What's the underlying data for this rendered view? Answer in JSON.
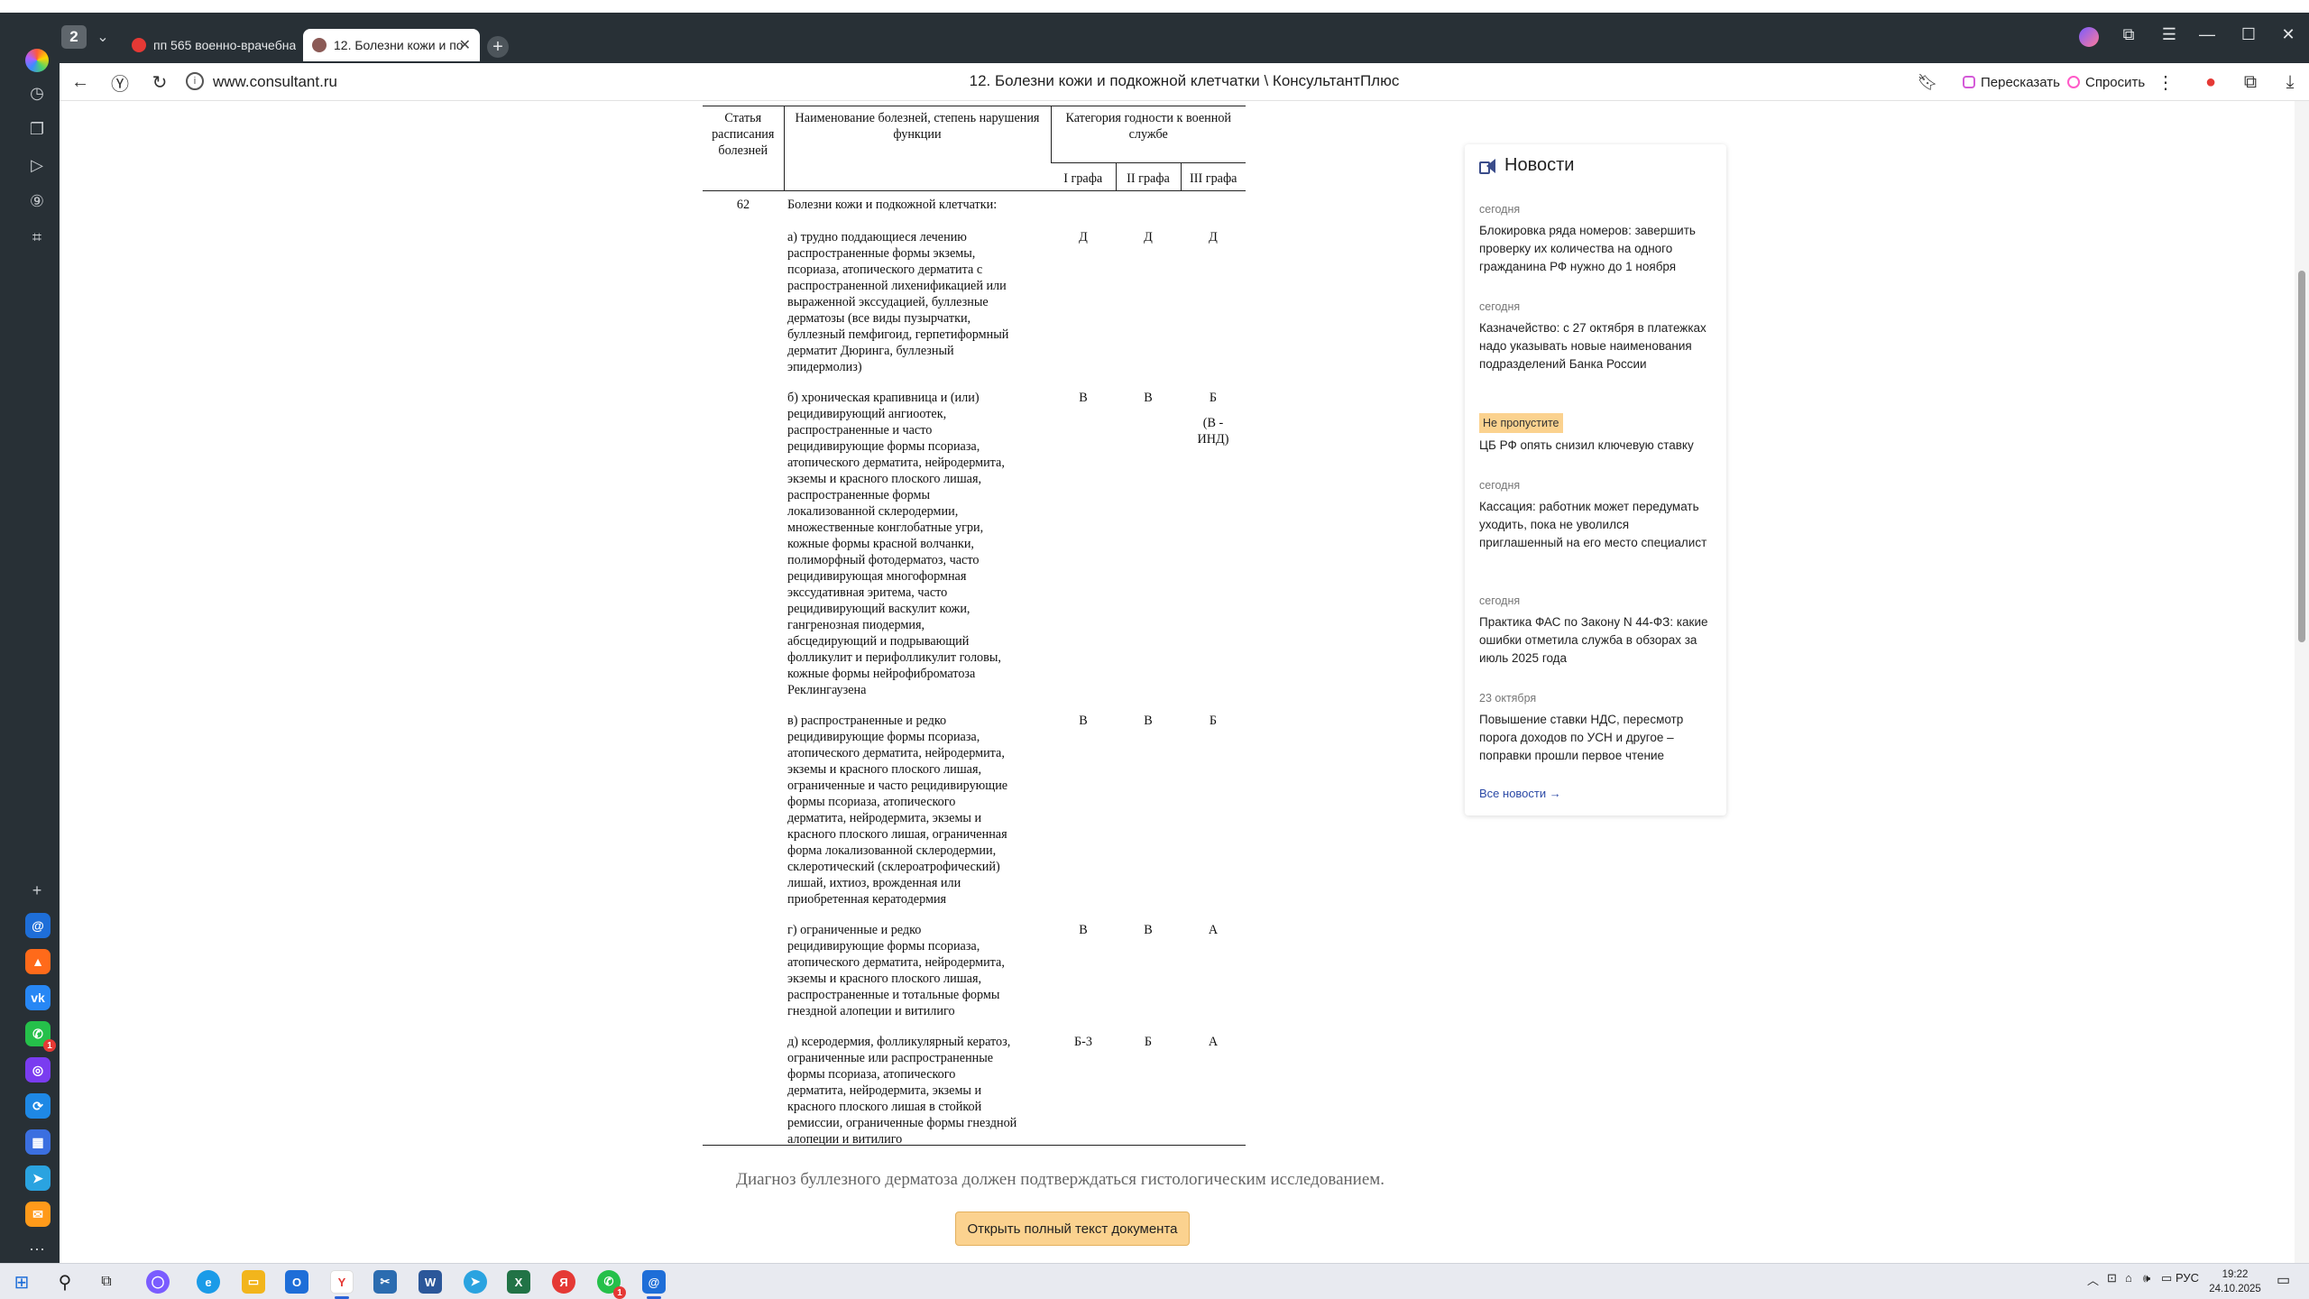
{
  "browser": {
    "tab_count": "2",
    "tabs": [
      {
        "label": "пп 565 военно-врачебна",
        "active": false
      },
      {
        "label": "12. Болезни кожи и по",
        "active": true
      }
    ],
    "url": "www.consultant.ru",
    "page_title": "12. Болезни кожи и подкожной клетчатки \\ КонсультантПлюс",
    "buttons": {
      "retell": "Пересказать",
      "ask": "Спросить"
    }
  },
  "doc": {
    "headers": {
      "col1": "Статья расписания болезней",
      "col2": "Наименование болезней, степень нарушения функции",
      "col_group": "Категория годности к военной службе",
      "g1": "I графа",
      "g2": "II графа",
      "g3": "III графа"
    },
    "article_number": "62",
    "article_title": "Болезни кожи и подкожной клетчатки:",
    "rows": [
      {
        "text": "а) трудно поддающиеся лечению\nраспространенные формы экземы,\nпсориаза, атопического дерматита с\nраспространенной лихенификацией или\nвыраженной экссудацией, буллезные\nдерматозы (все виды пузырчатки,\nбуллезный пемфигоид, герпетиформный\nдерматит Дюринга, буллезный\nэпидермолиз)",
        "g1": "Д",
        "g2": "Д",
        "g3": "Д",
        "g3_note": ""
      },
      {
        "text": "б) хроническая крапивница и (или)\nрецидивирующий ангиоотек,\nраспространенные и часто\nрецидивирующие формы псориаза,\nатопического дерматита, нейродермита,\nэкземы и красного плоского лишая,\nраспространенные формы\nлокализованной склеродермии,\nмножественные конглобатные угри,\nкожные формы красной волчанки,\nполиморфный фотодерматоз, часто\nрецидивирующая многоформная\nэкссудативная эритема, часто\nрецидивирующий васкулит кожи,\nгангренозная пиодермия,\nабсцедирующий и подрывающий\nфолликулит и перифолликулит головы,\nкожные формы нейрофиброматоза\nРеклингаузена",
        "g1": "В",
        "g2": "В",
        "g3": "Б",
        "g3_note": "(В -\nИНД)"
      },
      {
        "text": "в) распространенные и редко\nрецидивирующие формы псориаза,\nатопического дерматита, нейродермита,\nэкземы и красного плоского лишая,\nограниченные и часто рецидивирующие\nформы псориаза, атопического\nдерматита, нейродермита, экземы и\nкрасного плоского лишая, ограниченная\nформа локализованной склеродермии,\nсклеротический (склероатрофический)\nлишай, ихтиоз, врожденная или\nприобретенная кератодермия",
        "g1": "В",
        "g2": "В",
        "g3": "Б",
        "g3_note": ""
      },
      {
        "text": "г) ограниченные и редко\nрецидивирующие формы псориаза,\nатопического дерматита, нейродермита,\nэкземы и красного плоского лишая,\nраспространенные и тотальные формы\nгнездной алопеции и витилиго",
        "g1": "В",
        "g2": "В",
        "g3": "А",
        "g3_note": ""
      },
      {
        "text": "д) ксеродермия, фолликулярный кератоз,\nограниченные или распространенные\nформы псориаза, атопического\nдерматита, нейродермита, экземы и\nкрасного плоского лишая в стойкой\nремиссии, ограниченные формы гнездной\nалопеции и витилиго",
        "g1": "Б-3",
        "g2": "Б",
        "g3": "А",
        "g3_note": ""
      }
    ],
    "footnote": "Диагноз буллезного дерматоза должен подтверждаться гистологическим исследованием.",
    "open_full_text": "Открыть полный текст документа"
  },
  "news": {
    "title": "Новости",
    "items": [
      {
        "date": "сегодня",
        "tag": "",
        "text": "Блокировка ряда номеров: завершить проверку их количества на одного гражданина РФ нужно до 1 ноября"
      },
      {
        "date": "сегодня",
        "tag": "",
        "text": "Казначейство: с 27 октября в платежках надо указывать новые наименования подразделений Банка России"
      },
      {
        "date": "",
        "tag": "Не пропустите",
        "text": "ЦБ РФ опять снизил ключевую ставку"
      },
      {
        "date": "сегодня",
        "tag": "",
        "text": "Кассация: работник может передумать уходить, пока не уволился приглашенный на его место специалист"
      },
      {
        "date": "сегодня",
        "tag": "",
        "text": "Практика ФАС по Закону N 44-ФЗ: какие ошибки отметила служба в обзорах за июль 2025 года"
      },
      {
        "date": "23 октября",
        "tag": "",
        "text": "Повышение ставки НДС, пересмотр порога доходов по УСН и другое – поправки прошли первое чтение"
      }
    ],
    "all_link": "Все новости →"
  },
  "taskbar": {
    "lang": "РУС",
    "time": "19:22",
    "date": "24.10.2025"
  },
  "sidebar_badges": {
    "whatsapp": "1",
    "taskbar_whatsapp": "1"
  },
  "colors": {
    "accent": "#fbd28f",
    "chrome": "#283036",
    "link": "#2c4aa6"
  }
}
